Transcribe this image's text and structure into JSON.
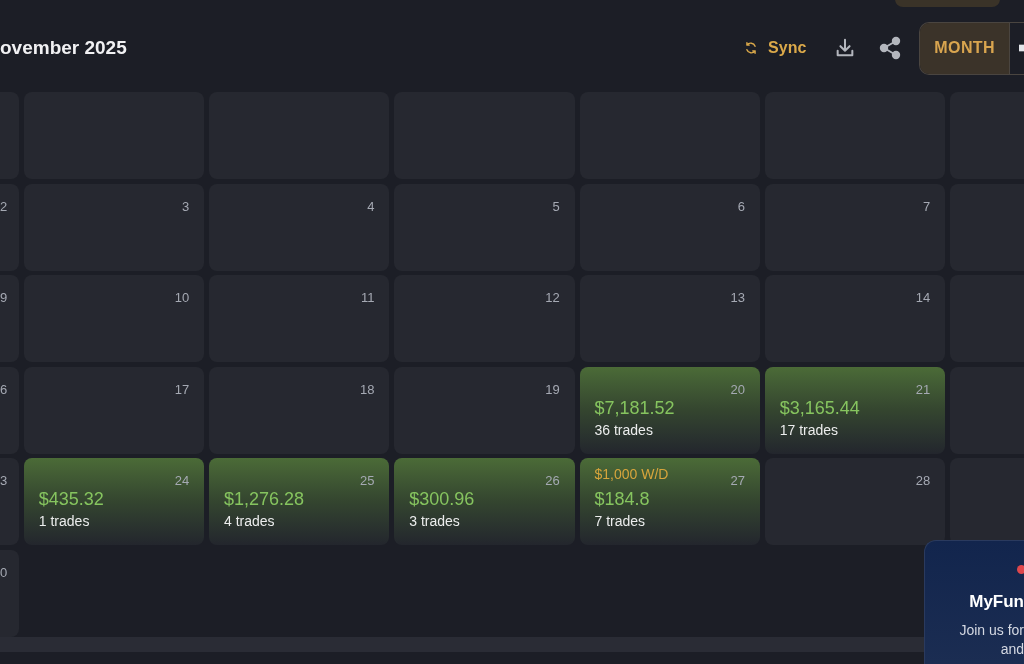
{
  "toolbar": {
    "title": "ovember 2025",
    "sync": {
      "label": "Sync"
    },
    "view_tabs": [
      {
        "label": "MONTH",
        "selected": true
      },
      {
        "selected": false
      }
    ]
  },
  "calendar": {
    "weeks": [
      {
        "days": [
          {
            "kind": "empty"
          },
          {
            "kind": "empty"
          },
          {
            "kind": "empty"
          },
          {
            "kind": "empty"
          },
          {
            "kind": "empty"
          },
          {
            "kind": "empty"
          },
          {
            "kind": "empty"
          }
        ]
      },
      {
        "days": [
          {
            "kind": "empty",
            "day": "2"
          },
          {
            "kind": "empty",
            "day": "3"
          },
          {
            "kind": "empty",
            "day": "4"
          },
          {
            "kind": "empty",
            "day": "5"
          },
          {
            "kind": "empty",
            "day": "6"
          },
          {
            "kind": "empty",
            "day": "7"
          },
          {
            "kind": "empty"
          }
        ]
      },
      {
        "days": [
          {
            "kind": "empty",
            "day": "9"
          },
          {
            "kind": "empty",
            "day": "10"
          },
          {
            "kind": "empty",
            "day": "11"
          },
          {
            "kind": "empty",
            "day": "12"
          },
          {
            "kind": "empty",
            "day": "13"
          },
          {
            "kind": "empty",
            "day": "14"
          },
          {
            "kind": "empty"
          }
        ]
      },
      {
        "days": [
          {
            "kind": "empty",
            "day": "6"
          },
          {
            "kind": "empty",
            "day": "17"
          },
          {
            "kind": "empty",
            "day": "18"
          },
          {
            "kind": "empty",
            "day": "19"
          },
          {
            "kind": "profit",
            "day": "20",
            "pnl": "$7,181.52",
            "trades": "36 trades"
          },
          {
            "kind": "profit",
            "day": "21",
            "pnl": "$3,165.44",
            "trades": "17 trades"
          },
          {
            "kind": "empty"
          }
        ]
      },
      {
        "days": [
          {
            "kind": "empty",
            "day": "3"
          },
          {
            "kind": "profit",
            "day": "24",
            "pnl": "$435.32",
            "trades": "1 trades"
          },
          {
            "kind": "profit",
            "day": "25",
            "pnl": "$1,276.28",
            "trades": "4 trades"
          },
          {
            "kind": "profit",
            "day": "26",
            "pnl": "$300.96",
            "trades": "3 trades"
          },
          {
            "kind": "profit",
            "day": "27",
            "withdrawal": "$1,000 W/D",
            "pnl": "$184.8",
            "trades": "7 trades"
          },
          {
            "kind": "empty",
            "day": "28"
          },
          {
            "kind": "empty"
          }
        ]
      },
      {
        "days": [
          {
            "kind": "empty",
            "day": "0"
          }
        ]
      }
    ]
  },
  "promo": {
    "title": "MyFun",
    "lines": [
      "Join us for",
      "and"
    ]
  }
}
